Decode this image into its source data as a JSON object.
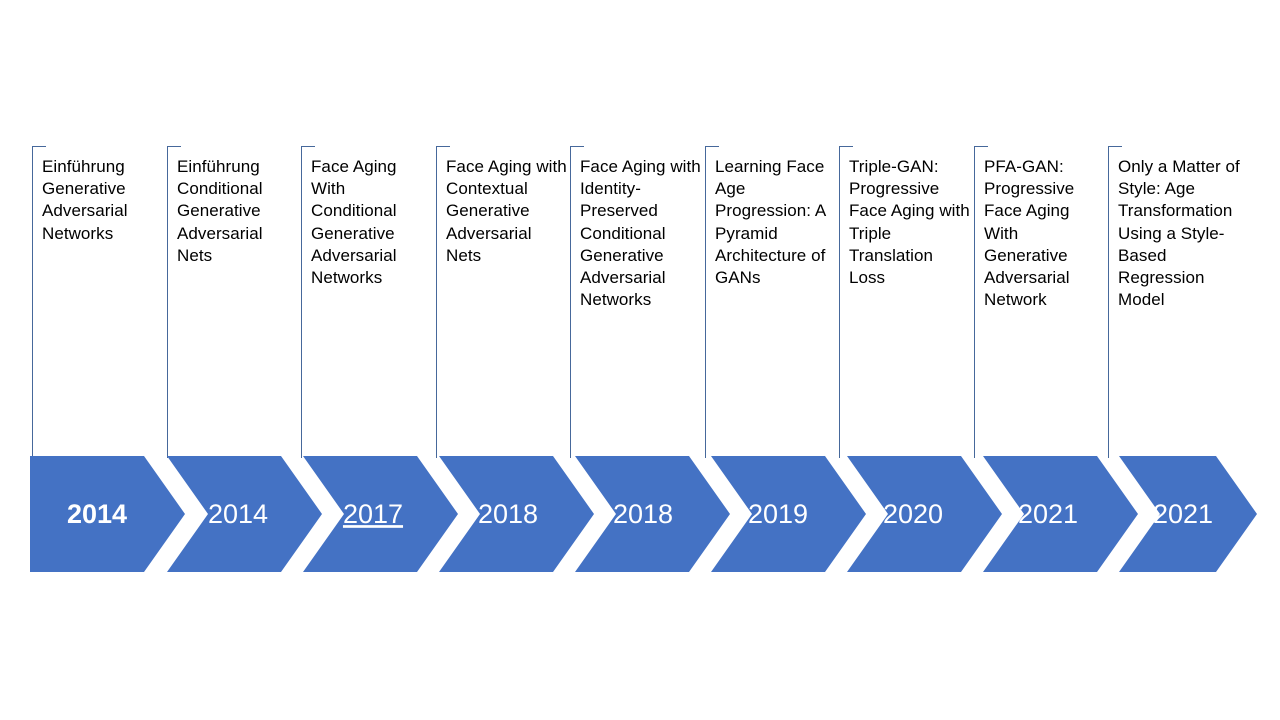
{
  "slide": {
    "background_color": "#ffffff",
    "chevron_color": "#4472C4",
    "bracket_color": "#46689B",
    "year_text_color": "#ffffff",
    "title_text_color": "#000000"
  },
  "timeline": {
    "milestones": [
      {
        "year": "2014",
        "title": "Einführung Generative Adversarial Networks",
        "year_bold": true,
        "year_underline": false
      },
      {
        "year": "2014",
        "title": "Einführung Conditional Generative Adversarial Nets",
        "year_bold": false,
        "year_underline": false
      },
      {
        "year": "2017",
        "title": "Face Aging With Conditional Generative Adversarial Networks",
        "year_bold": false,
        "year_underline": true
      },
      {
        "year": "2018",
        "title": "Face Aging with Contextual Generative Adversarial Nets",
        "year_bold": false,
        "year_underline": false
      },
      {
        "year": "2018",
        "title": "Face Aging with Identity-Preserved Conditional Generative Adversarial Networks",
        "year_bold": false,
        "year_underline": false
      },
      {
        "year": "2019",
        "title": "Learning Face Age Progression: A Pyramid Architecture of GANs",
        "year_bold": false,
        "year_underline": false
      },
      {
        "year": "2020",
        "title": "Triple-GAN: Progressive Face Aging with Triple Translation Loss",
        "year_bold": false,
        "year_underline": false
      },
      {
        "year": "2021",
        "title": "PFA-GAN: Progressive Face Aging With Generative Adversarial Network",
        "year_bold": false,
        "year_underline": false
      },
      {
        "year": "2021",
        "title": "Only a Matter of Style: Age Transformation Using a Style-Based Regression Model",
        "year_bold": false,
        "year_underline": false
      }
    ]
  }
}
